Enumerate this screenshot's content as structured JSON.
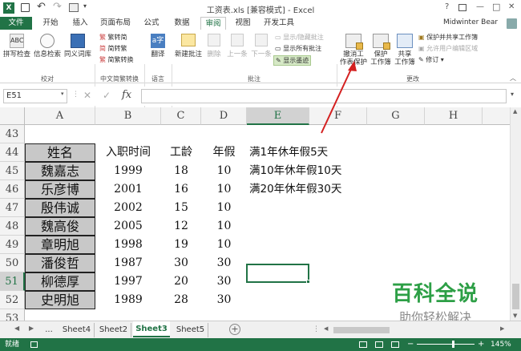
{
  "title_bar": {
    "title": "工资表.xls [兼容模式] - Excel",
    "help": "?",
    "minimize": "—",
    "restore": "□",
    "close": "✕"
  },
  "tabs": {
    "file": "文件",
    "items": [
      "开始",
      "插入",
      "页面布局",
      "公式",
      "数据",
      "审阅",
      "视图",
      "开发工具"
    ],
    "active": "审阅",
    "user": "Midwinter Bear"
  },
  "ribbon": {
    "proofing": {
      "spell": "拼写检查",
      "research": "信息检索",
      "thesaurus": "同义词库",
      "group": "校对"
    },
    "chinese": {
      "to_trad": "繁转简",
      "to_simp": "简转繁",
      "convert": "简繁转换",
      "group": "中文简繁转换"
    },
    "language": {
      "translate": "翻译",
      "group": "语言"
    },
    "comments": {
      "new": "新建批注",
      "delete": "删除",
      "prev": "上一条",
      "next": "下一条",
      "show_hide": "显示/隐藏批注",
      "show_all": "显示所有批注",
      "show_ink": "显示墨迹",
      "group": "批注"
    },
    "changes": {
      "unprotect_line1": "撤消工",
      "unprotect_line2": "作表保护",
      "protect_wb_line1": "保护",
      "protect_wb_line2": "工作簿",
      "share_line1": "共享",
      "share_line2": "工作簿",
      "protect_share": "保护并共享工作簿",
      "allow_edit": "允许用户编辑区域",
      "track": "修订",
      "group": "更改"
    }
  },
  "formula_bar": {
    "name_box": "E51",
    "fx": "fx",
    "cancel": "✕",
    "enter": "✓"
  },
  "columns": [
    "A",
    "B",
    "C",
    "D",
    "E",
    "F",
    "G",
    "H"
  ],
  "rows": [
    "43",
    "44",
    "45",
    "46",
    "47",
    "48",
    "49",
    "50",
    "51",
    "52",
    "53"
  ],
  "table": {
    "headers": [
      "姓名",
      "入职时间",
      "工龄",
      "年假"
    ],
    "names": [
      "魏嘉志",
      "乐彦博",
      "殷伟诚",
      "魏高俊",
      "章明旭",
      "潘俊哲",
      "柳德厚",
      "史明旭"
    ],
    "years": [
      "1999",
      "2001",
      "2002",
      "2005",
      "1998",
      "1987",
      "1997",
      "1989"
    ],
    "seniority": [
      "18",
      "16",
      "15",
      "12",
      "19",
      "30",
      "20",
      "28"
    ],
    "leave": [
      "10",
      "10",
      "10",
      "10",
      "10",
      "30",
      "30",
      "30"
    ]
  },
  "notes": [
    "满1年休年假5天",
    "满10年休年假10天",
    "满20年休年假30天"
  ],
  "sheets": {
    "nav_more": "...",
    "items": [
      "Sheet4",
      "Sheet2",
      "Sheet3",
      "Sheet5"
    ],
    "active": "Sheet3",
    "add": "+"
  },
  "watermark": {
    "brand": "百科全说",
    "slogan": "助你轻松解决"
  },
  "status": {
    "ready": "就绪",
    "zoom": "145%"
  },
  "colors": {
    "excel_green": "#217346",
    "name_fill": "#c8c8c8",
    "arrow": "#d42020",
    "watermark_green": "#2d9f46"
  }
}
